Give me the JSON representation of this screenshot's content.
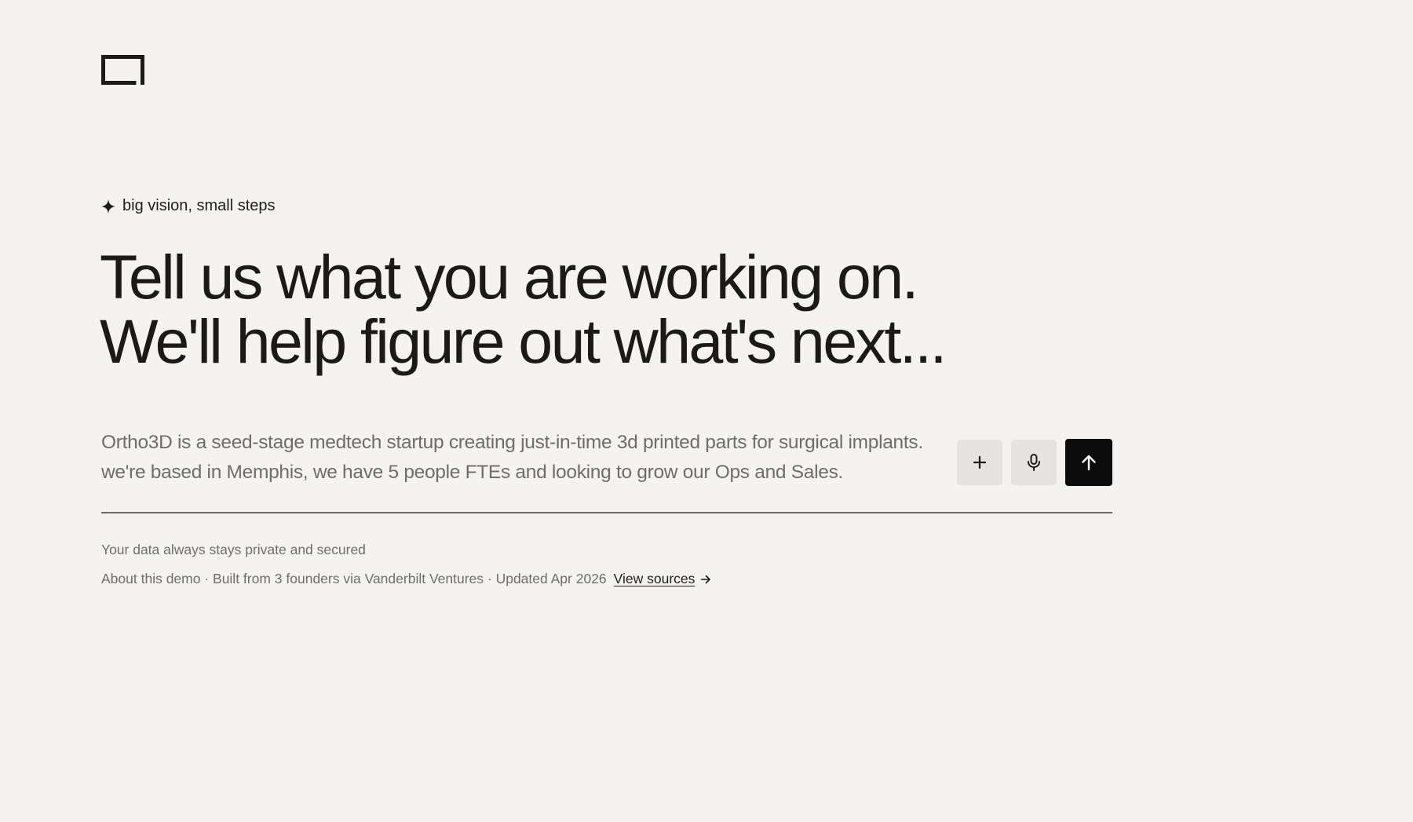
{
  "brand": {
    "logo_icon": "bracket-logo-icon"
  },
  "hero": {
    "tagline_icon": "sparkle-icon",
    "tagline": "big vision, small steps",
    "headline_line1": "Tell us what you are working on.",
    "headline_line2": "We'll help figure out what's next..."
  },
  "prompt": {
    "line1": "Ortho3D is a seed-stage medtech startup creating just-in-time 3d printed parts for surgical implants.",
    "line2": "we're based in Memphis, we have 5 people FTEs and looking to grow our Ops and Sales.",
    "add_icon": "plus-icon",
    "mic_icon": "microphone-icon",
    "send_icon": "arrow-up-icon"
  },
  "footer": {
    "privacy": "Your data always stays private and secured",
    "about": "About this demo · Built from 3 founders via Vanderbilt Ventures · Updated Apr 2026",
    "link_label": "View sources",
    "link_icon": "arrow-right-icon"
  },
  "colors": {
    "background": "#f4f3f1",
    "text": "#1a1918",
    "muted_text": "#6f6d6a",
    "secondary_button": "#e5e4e2",
    "primary_button": "#0c0c0c"
  }
}
